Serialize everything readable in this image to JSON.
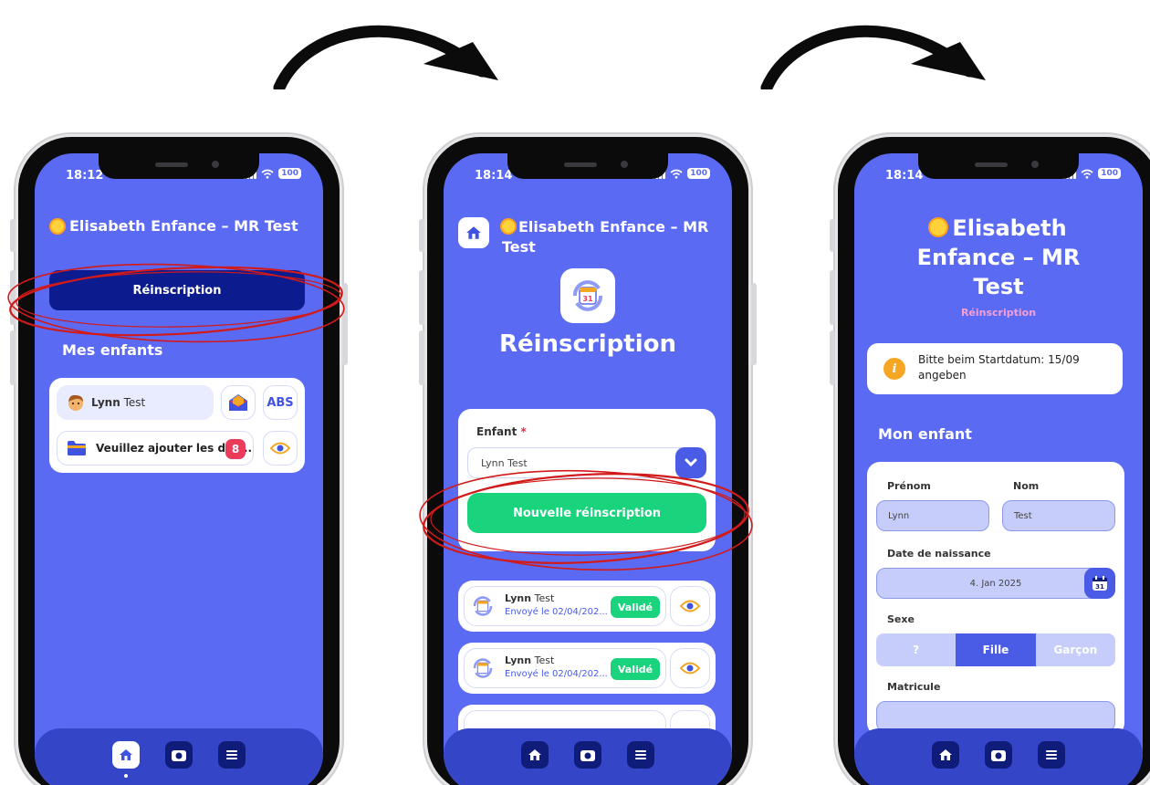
{
  "colors": {
    "screen_bg": "#5b6af2",
    "nav_bg": "#3545c7",
    "primary_dark": "#0c1b8e",
    "accent": "#4a5be6",
    "success": "#19d37d",
    "danger": "#ea3b5a",
    "highlight_circle": "#d11a1a",
    "info": "#f5a623"
  },
  "phone1": {
    "status": {
      "time": "18:12",
      "battery": "100"
    },
    "title": "Elisabeth Enfance – MR Test",
    "reinscription_button": "Réinscription",
    "section_title": "Mes enfants",
    "child": {
      "first_name": "Lynn",
      "last_name": "Test",
      "abs_label": "ABS"
    },
    "documents": {
      "label": "Veuillez ajouter les doc...",
      "count": "8"
    }
  },
  "phone2": {
    "status": {
      "time": "18:14",
      "battery": "100"
    },
    "title": "Elisabeth Enfance – MR Test",
    "page_title": "Réinscription",
    "form": {
      "enfant_label": "Enfant",
      "required_mark": "*",
      "selected_child": "Lynn Test",
      "submit_button": "Nouvelle réinscription"
    },
    "entries": [
      {
        "first_name": "Lynn",
        "last_name": "Test",
        "sent": "Envoyé le 02/04/202...",
        "status": "Validé"
      },
      {
        "first_name": "Lynn",
        "last_name": "Test",
        "sent": "Envoyé le 02/04/202...",
        "status": "Validé"
      }
    ]
  },
  "phone3": {
    "status": {
      "time": "18:14",
      "battery": "100"
    },
    "title_line1": "Elisabeth",
    "title_line2": "Enfance – MR",
    "title_line3": "Test",
    "subtitle": "Réinscription",
    "info": "Bitte beim Startdatum: 15/09 angeben",
    "section_title": "Mon enfant",
    "form": {
      "prenom_label": "Prénom",
      "prenom_value": "Lynn",
      "nom_label": "Nom",
      "nom_value": "Test",
      "dob_label": "Date de naissance",
      "dob_value": "4. Jan 2025",
      "sexe_label": "Sexe",
      "sexe_options": [
        "?",
        "Fille",
        "Garçon"
      ],
      "sexe_selected": "Fille",
      "matricule_label": "Matricule"
    }
  },
  "icons": {
    "nav": [
      "home-icon",
      "camera-icon",
      "menu-icon"
    ],
    "calendar_day": "31"
  }
}
